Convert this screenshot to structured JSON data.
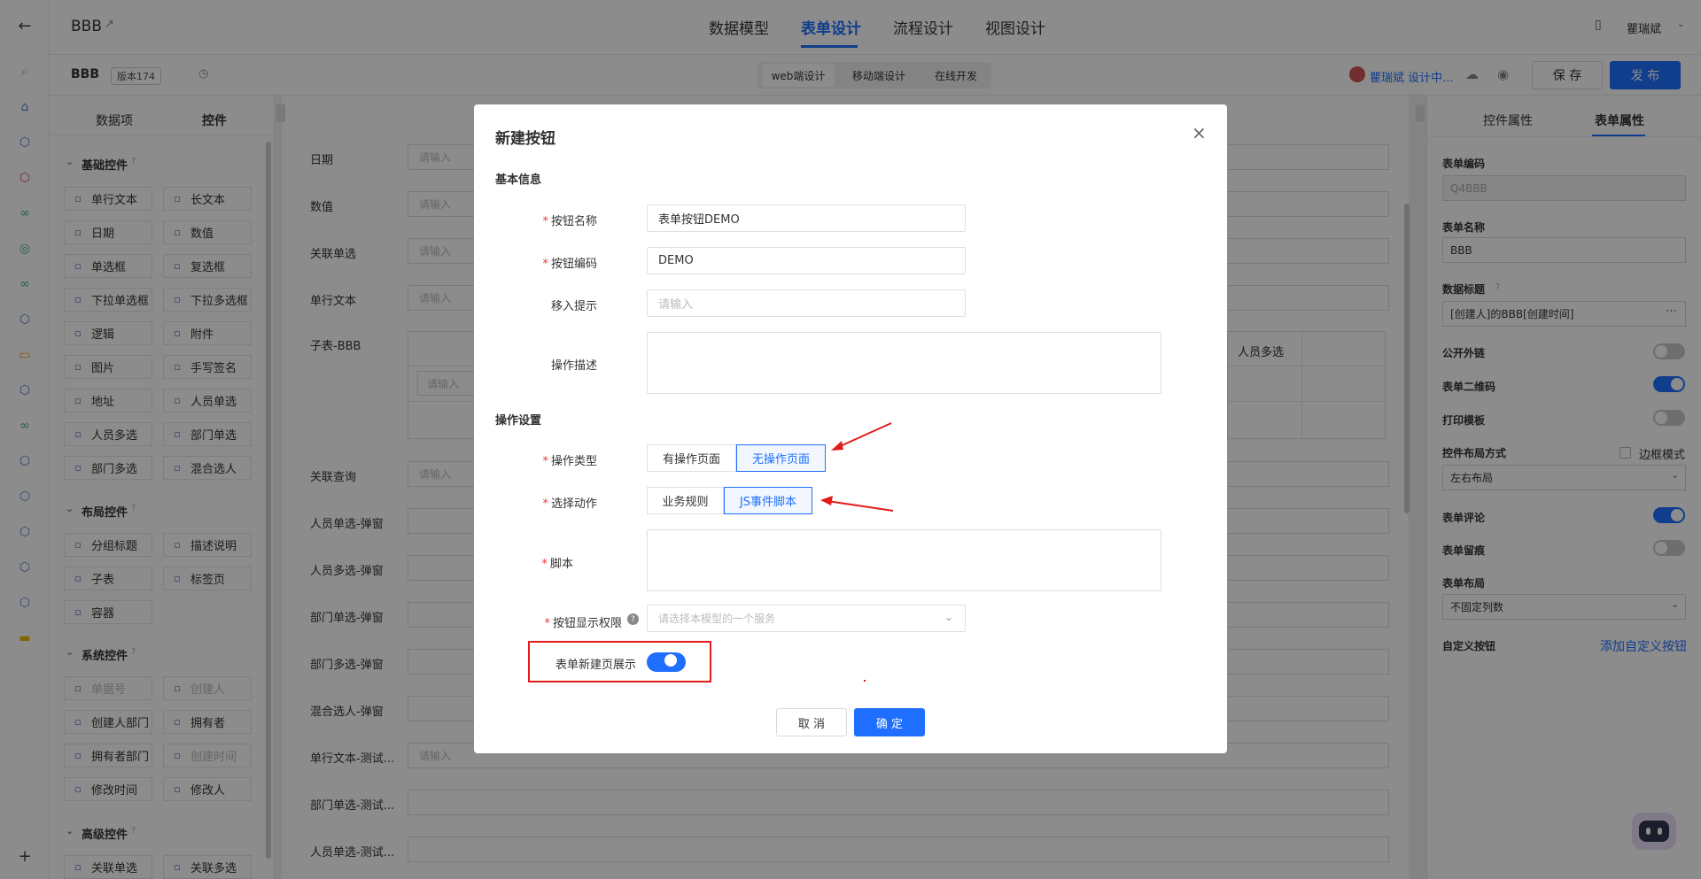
{
  "app": {
    "title": "BBB",
    "version": "版本174",
    "user": "瞿瑞斌"
  },
  "top_tabs": [
    "数据模型",
    "表单设计",
    "流程设计",
    "视图设计"
  ],
  "platform_tabs": [
    "web端设计",
    "移动端设计",
    "在线开发"
  ],
  "toolbar": {
    "designer_status": "瞿瑞斌 设计中...",
    "save_label": "保 存",
    "publish_label": "发 布"
  },
  "left_panel": {
    "tabs": [
      "数据项",
      "控件"
    ],
    "sections": {
      "basic": "基础控件",
      "layout": "布局控件",
      "system": "系统控件",
      "advanced": "高级控件"
    },
    "basic_controls": [
      "单行文本",
      "长文本",
      "日期",
      "数值",
      "单选框",
      "复选框",
      "下拉单选框",
      "下拉多选框",
      "逻辑",
      "附件",
      "图片",
      "手写签名",
      "地址",
      "人员单选",
      "人员多选",
      "部门单选",
      "部门多选",
      "混合选人"
    ],
    "layout_controls": [
      "分组标题",
      "描述说明",
      "子表",
      "标签页",
      "容器"
    ],
    "system_controls": [
      "单据号",
      "创建人",
      "创建人部门",
      "拥有者",
      "拥有者部门",
      "创建时间",
      "修改时间",
      "修改人"
    ],
    "advanced_controls": [
      "关联单选",
      "关联多选"
    ]
  },
  "canvas": {
    "rows": [
      {
        "label": "日期",
        "placeholder": "请输入"
      },
      {
        "label": "数值",
        "placeholder": "请输入"
      },
      {
        "label": "关联单选",
        "placeholder": "请输入"
      },
      {
        "label": "单行文本",
        "placeholder": "请输入"
      }
    ],
    "subtable_label": "子表-BBB",
    "subtable_col": "人员多选",
    "subtable_placeholder": "请输入",
    "rows2": [
      {
        "label": "关联查询",
        "placeholder": "请输入"
      },
      {
        "label": "人员单选-弹窗",
        "placeholder": ""
      },
      {
        "label": "人员多选-弹窗",
        "placeholder": ""
      },
      {
        "label": "部门单选-弹窗",
        "placeholder": ""
      },
      {
        "label": "部门多选-弹窗",
        "placeholder": ""
      },
      {
        "label": "混合选人-弹窗",
        "placeholder": ""
      },
      {
        "label": "单行文本-测试...",
        "placeholder": "请输入"
      },
      {
        "label": "部门单选-测试...",
        "placeholder": ""
      },
      {
        "label": "人员单选-测试...",
        "placeholder": ""
      }
    ]
  },
  "right_panel": {
    "tabs": [
      "控件属性",
      "表单属性"
    ],
    "form_code_label": "表单编码",
    "form_code": "Q4BBB",
    "form_name_label": "表单名称",
    "form_name": "BBB",
    "data_title_label": "数据标题",
    "data_title": "[创建人]的BBB[创建时间]",
    "public_link": "公开外链",
    "qr_code": "表单二维码",
    "print_template": "打印模板",
    "layout_mode_label": "控件布局方式",
    "border_mode": "边框模式",
    "layout_mode": "左右布局",
    "comments": "表单评论",
    "trace": "表单留痕",
    "form_layout_label": "表单布局",
    "form_layout": "不固定列数",
    "custom_button_label": "自定义按钮",
    "add_custom_button": "添加自定义按钮",
    "toggles": {
      "public_link": false,
      "qr_code": true,
      "print_template": false,
      "comments": true,
      "trace": false
    }
  },
  "modal": {
    "title": "新建按钮",
    "basic_info": "基本信息",
    "name_label": "按钮名称",
    "name_value": "表单按钮DEMO",
    "code_label": "按钮编码",
    "code_value": "DEMO",
    "hover_label": "移入提示",
    "hover_placeholder": "请输入",
    "desc_label": "操作描述",
    "op_settings": "操作设置",
    "op_type_label": "操作类型",
    "op_type_options": [
      "有操作页面",
      "无操作页面"
    ],
    "op_type_selected": "无操作页面",
    "action_label": "选择动作",
    "action_options": [
      "业务规则",
      "JS事件脚本"
    ],
    "action_selected": "JS事件脚本",
    "script_label": "脚本",
    "perm_label": "按钮显示权限",
    "perm_placeholder": "请选择本模型的一个服务",
    "show_new_label": "表单新建页展示",
    "show_new_on": true,
    "cancel_label": "取 消",
    "ok_label": "确 定"
  },
  "colors": {
    "accent": "#1e6fff",
    "required": "#e33333",
    "annotation": "#e31b1b"
  }
}
